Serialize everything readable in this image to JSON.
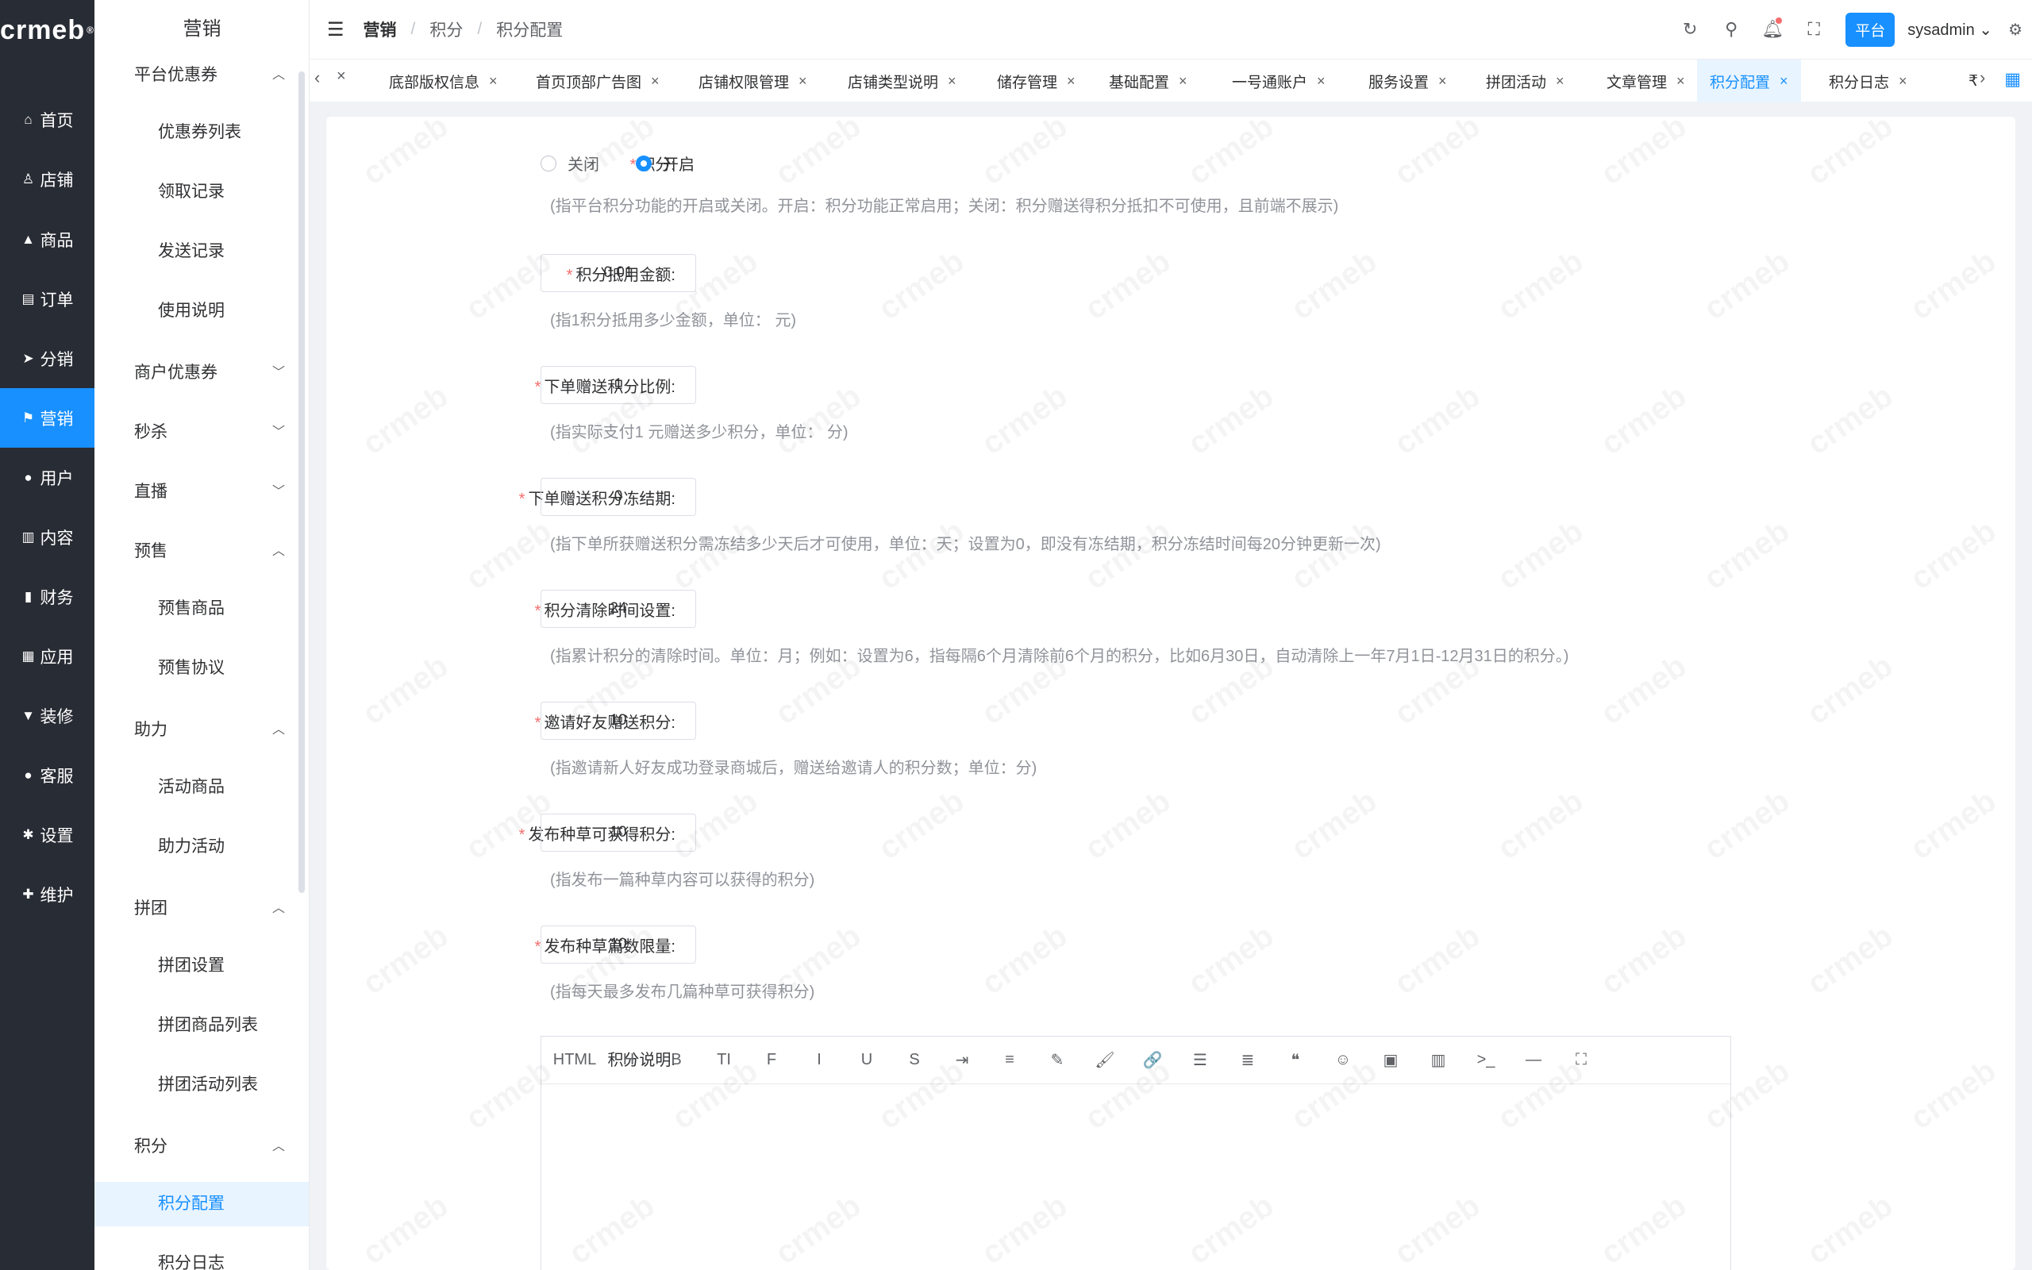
{
  "logo": {
    "text": "crmeb",
    "mark": "®"
  },
  "nav": [
    {
      "label": "首页",
      "icon": "⌂",
      "icon_name": "home-icon"
    },
    {
      "label": "店铺",
      "icon": "♙",
      "icon_name": "store-icon"
    },
    {
      "label": "商品",
      "icon": "▲",
      "icon_name": "product-icon"
    },
    {
      "label": "订单",
      "icon": "▤",
      "icon_name": "order-icon"
    },
    {
      "label": "分销",
      "icon": "➤",
      "icon_name": "distribution-icon"
    },
    {
      "label": "营销",
      "icon": "⚑",
      "icon_name": "marketing-icon"
    },
    {
      "label": "用户",
      "icon": "●",
      "icon_name": "user-icon"
    },
    {
      "label": "内容",
      "icon": "▥",
      "icon_name": "content-icon"
    },
    {
      "label": "财务",
      "icon": "▮",
      "icon_name": "finance-icon"
    },
    {
      "label": "应用",
      "icon": "▦",
      "icon_name": "apps-icon"
    },
    {
      "label": "装修",
      "icon": "▼",
      "icon_name": "decoration-icon"
    },
    {
      "label": "客服",
      "icon": "●",
      "icon_name": "service-icon"
    },
    {
      "label": "设置",
      "icon": "✱",
      "icon_name": "settings-icon"
    },
    {
      "label": "维护",
      "icon": "✚",
      "icon_name": "maintenance-icon"
    }
  ],
  "submenu": {
    "title": "营销",
    "groups": [
      {
        "label": "平台优惠券",
        "chev": "^"
      },
      {
        "label": "商户优惠券",
        "chev": "v"
      },
      {
        "label": "秒杀",
        "chev": "v"
      },
      {
        "label": "直播",
        "chev": "v"
      },
      {
        "label": "预售",
        "chev": "^"
      },
      {
        "label": "助力",
        "chev": "^"
      },
      {
        "label": "拼团",
        "chev": "^"
      },
      {
        "label": "积分",
        "chev": "^"
      }
    ],
    "items": [
      "优惠券列表",
      "领取记录",
      "发送记录",
      "使用说明",
      "预售商品",
      "预售协议",
      "活动商品",
      "助力活动",
      "拼团设置",
      "拼团商品列表",
      "拼团活动列表",
      "积分配置",
      "积分日志"
    ]
  },
  "header": {
    "breadcrumb": [
      "营销",
      "积分",
      "积分配置"
    ],
    "sep": "/",
    "platform_label": "平台",
    "user": "sysadmin"
  },
  "tabs": [
    "底部版权信息",
    "首页顶部广告图",
    "店铺权限管理",
    "店铺类型说明",
    "储存管理",
    "基础配置",
    "一号通账户",
    "服务设置",
    "拼团活动",
    "文章管理",
    "积分配置",
    "积分日志",
    "₹"
  ],
  "form": {
    "switch": {
      "label": "积分:",
      "options": [
        "关闭",
        "开启"
      ],
      "selected": "开启",
      "hint": "(指平台积分功能的开启或关闭。开启：积分功能正常启用；关闭：积分赠送得积分抵扣不可使用，且前端不展示)"
    },
    "fields": [
      {
        "label": "积分抵用金额:",
        "value": "0.01",
        "hint": "(指1积分抵用多少金额，单位： 元)"
      },
      {
        "label": "下单赠送积分比例:",
        "value": "1",
        "hint": "(指实际支付1 元赠送多少积分，单位： 分)"
      },
      {
        "label": "下单赠送积分冻结期:",
        "value": "0",
        "hint": "(指下单所获赠送积分需冻结多少天后才可使用，单位：天；设置为0，即没有冻结期，积分冻结时间每20分钟更新一次)"
      },
      {
        "label": "积分清除时间设置:",
        "value": "24",
        "hint": "(指累计积分的清除时间。单位：月；例如：设置为6，指每隔6个月清除前6个月的积分，比如6月30日，自动清除上一年7月1日-12月31日的积分。)"
      },
      {
        "label": "邀请好友赠送积分:",
        "value": "10",
        "hint": "(指邀请新人好友成功登录商城后，赠送给邀请人的积分数；单位：分)"
      },
      {
        "label": "发布种草可获得积分:",
        "value": "10",
        "hint": "(指发布一篇种草内容可以获得的积分)"
      },
      {
        "label": "发布种草篇数限量:",
        "value": "10",
        "hint": "(指每天最多发布几篇种草可获得积分)"
      }
    ],
    "desc_label": "积分说明:",
    "toolbar": [
      "HTML",
      "H",
      "B",
      "TI",
      "F",
      "I",
      "U",
      "S",
      "⇥",
      "≡",
      "✎",
      "🖌",
      "🔗",
      "☰",
      "≣",
      "❝",
      "☺",
      "▣",
      "▥",
      ">_",
      "—",
      "⛶"
    ]
  },
  "watermark": "crmeb",
  "colors": {
    "accent": "#1890ff",
    "nav_bg": "#282c34",
    "required": "#f56c6c"
  }
}
